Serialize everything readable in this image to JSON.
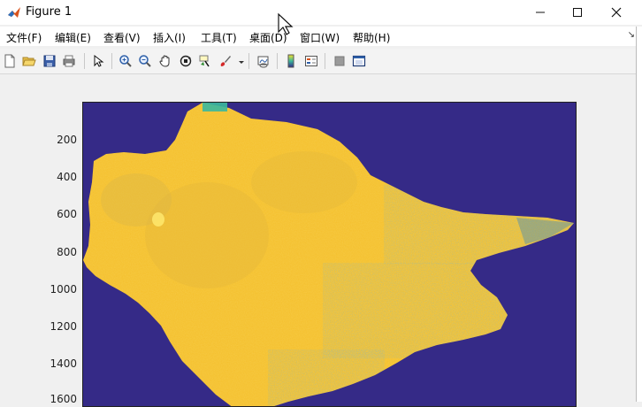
{
  "window": {
    "title": "Figure 1"
  },
  "menu": [
    "文件(F)",
    "编辑(E)",
    "查看(V)",
    "插入(I)",
    "工具(T)",
    "桌面(D)",
    "窗口(W)",
    "帮助(H)"
  ],
  "toolbar_icons": [
    "new-figure-icon",
    "open-file-icon",
    "save-icon",
    "print-icon",
    "pointer-icon",
    "zoom-in-icon",
    "zoom-out-icon",
    "pan-hand-icon",
    "rotate-3d-icon",
    "data-cursor-icon",
    "brush-icon",
    "link-plot-icon",
    "colorbar-icon",
    "legend-icon",
    "hide-plot-tools-icon",
    "show-plot-tools-icon"
  ],
  "axes": {
    "yticks": [
      "200",
      "400",
      "600",
      "800",
      "1000",
      "1200",
      "1400",
      "1600"
    ]
  },
  "colors": {
    "background": "#352a87",
    "land": "#f5bf2a",
    "land_dark": "#e8b93a",
    "water_edge": "#1f7fd3",
    "teal": "#3bb89d"
  }
}
